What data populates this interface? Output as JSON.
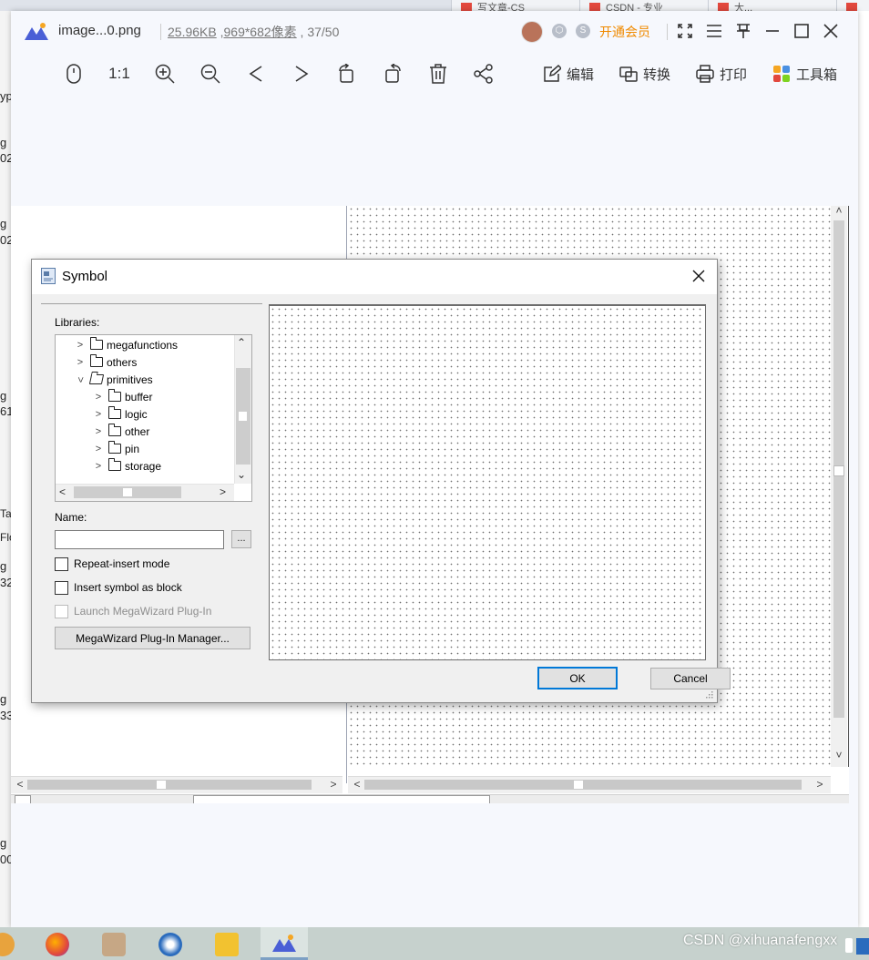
{
  "background": {
    "tabs": [
      {
        "label": "写文章-CS"
      },
      {
        "label": "CSDN - 专业"
      },
      {
        "label": "大..."
      }
    ],
    "left_fragments": [
      "yp",
      "g",
      "02",
      "g",
      "02",
      "g",
      "61",
      "Tas",
      "Flov",
      "g",
      "32",
      "g",
      "33",
      "g",
      "00"
    ]
  },
  "viewer": {
    "filename": "image...0.png",
    "filesize": "25.96KB",
    "dimensions": "969*682像素",
    "position": "37/50",
    "vip_label": "开通会员",
    "toolbar": {
      "ratio_label": "1:1",
      "edit_label": "编辑",
      "convert_label": "转换",
      "print_label": "打印",
      "toolbox_label": "工具箱"
    }
  },
  "dialog": {
    "title": "Symbol",
    "libraries_label": "Libraries:",
    "tree": [
      {
        "label": "megafunctions",
        "expanded": false,
        "level": 1
      },
      {
        "label": "others",
        "expanded": false,
        "level": 1
      },
      {
        "label": "primitives",
        "expanded": true,
        "level": 1
      },
      {
        "label": "buffer",
        "expanded": false,
        "level": 2
      },
      {
        "label": "logic",
        "expanded": false,
        "level": 2
      },
      {
        "label": "other",
        "expanded": false,
        "level": 2
      },
      {
        "label": "pin",
        "expanded": false,
        "level": 2
      },
      {
        "label": "storage",
        "expanded": false,
        "level": 2
      }
    ],
    "name_label": "Name:",
    "name_value": "",
    "browse_label": "...",
    "repeat_insert_label": "Repeat-insert mode",
    "insert_block_label": "Insert symbol as block",
    "launch_wizard_label": "Launch MegaWizard Plug-In",
    "wizard_manager_label": "MegaWizard Plug-In Manager...",
    "ok_label": "OK",
    "cancel_label": "Cancel"
  },
  "watermark": "CSDN @xihuanafengxx",
  "colors": {
    "vip": "#f08a00",
    "default_button_border": "#0078d7",
    "tab_favicon": "#e2483d"
  }
}
